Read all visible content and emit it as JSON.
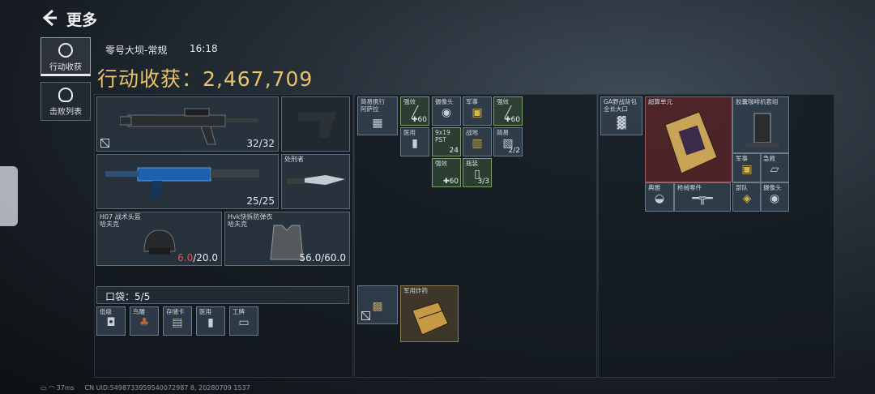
{
  "header": {
    "title": "更多"
  },
  "nav": [
    {
      "label": "行动收获",
      "selected": true
    },
    {
      "label": "击败列表",
      "selected": false
    }
  ],
  "match": {
    "map": "零号大坝-常规",
    "time": "16:18"
  },
  "haul": {
    "label": "行动收获：",
    "value": "2,467,709"
  },
  "gear": {
    "primary1": {
      "ammo": "32/32",
      "icon": "rifle-black-icon"
    },
    "pistol": {
      "icon": "pistol-icon"
    },
    "primary2": {
      "ammo": "25/25",
      "icon": "smg-blue-icon"
    },
    "melee": {
      "name": "处刑者",
      "icon": "knife-icon"
    },
    "helmet": {
      "name": "H07 战术头盔",
      "sub": "哈夫克",
      "current": "6.0",
      "max": "/20.0",
      "current_color": "#e2574c"
    },
    "armor": {
      "name": "Hvk快拆防弹衣",
      "sub": "哈夫克",
      "durability": "56.0/60.0"
    }
  },
  "pocket": {
    "label": "口袋：",
    "count": "5/5",
    "items": [
      {
        "label": "低级"
      },
      {
        "label": "鸟雕"
      },
      {
        "label": "存储卡"
      },
      {
        "label": "医用"
      },
      {
        "label": "工牌"
      }
    ]
  },
  "vest": {
    "items": [
      {
        "label": "简易携行\n阿萨拉"
      },
      {
        "label": "强效",
        "val": "60",
        "green": true
      },
      {
        "label": "摄像头"
      },
      {
        "label": "军事"
      },
      {
        "label": "强效",
        "val": "60",
        "green": true
      },
      {
        "label": "医用"
      },
      {
        "label": "9x19\nPST",
        "val": "24",
        "green": true
      },
      {
        "label": "战地"
      },
      {
        "label": "简易",
        "val": "2/2"
      },
      {
        "label": "强效",
        "val": "60",
        "green": true
      },
      {
        "label": "瓶装",
        "val": "3/3",
        "green": true
      }
    ]
  },
  "backpack": {
    "name": "军用炸药"
  },
  "case": {
    "items": [
      {
        "label": "GA野战背包\n全长大口"
      },
      {
        "label": "超算单元"
      },
      {
        "label": "胶囊咖啡机套组"
      },
      {
        "label": "军事"
      },
      {
        "label": "急救"
      },
      {
        "label": "典雅"
      },
      {
        "label": "枪械零件"
      },
      {
        "label": "部队"
      },
      {
        "label": "摄像头"
      }
    ]
  },
  "status": {
    "ping": "37ms",
    "uid": "CN UID:5498733959540072987 8, 20280709 1537"
  }
}
